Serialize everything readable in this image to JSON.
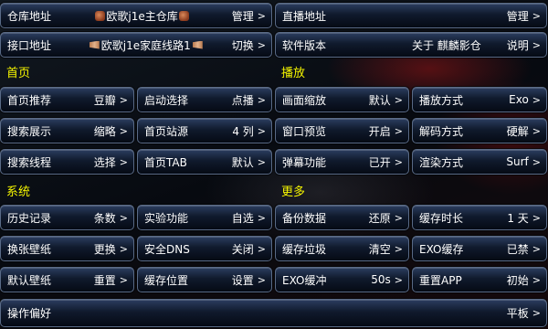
{
  "top": {
    "repo": {
      "label": "仓库地址",
      "value_pre": "",
      "value_mid": "欧歌j1e主仓库",
      "action": "管理"
    },
    "live": {
      "label": "直播地址",
      "action": "管理"
    },
    "api": {
      "label": "接口地址",
      "value_mid": "欧歌j1e家庭线路1",
      "action": "切换"
    },
    "version": {
      "label": "软件版本",
      "value": "关于 麒麟影仓",
      "action": "说明"
    }
  },
  "sections": {
    "home": "首页",
    "play": "播放",
    "system": "系统",
    "more": "更多"
  },
  "home_items": [
    {
      "label": "首页推荐",
      "value": "豆瓣"
    },
    {
      "label": "启动选择",
      "value": "点播"
    },
    {
      "label": "搜索展示",
      "value": "缩略"
    },
    {
      "label": "首页站源",
      "value": "4 列"
    },
    {
      "label": "搜索线程",
      "value": "选择"
    },
    {
      "label": "首页TAB",
      "value": "默认"
    }
  ],
  "play_items": [
    {
      "label": "画面缩放",
      "value": "默认"
    },
    {
      "label": "播放方式",
      "value": "Exo"
    },
    {
      "label": "窗口预览",
      "value": "开启"
    },
    {
      "label": "解码方式",
      "value": "硬解"
    },
    {
      "label": "弹幕功能",
      "value": "已开"
    },
    {
      "label": "渲染方式",
      "value": "Surf"
    }
  ],
  "system_items": [
    {
      "label": "历史记录",
      "value": "条数"
    },
    {
      "label": "实验功能",
      "value": "自选"
    },
    {
      "label": "换张壁纸",
      "value": "更换"
    },
    {
      "label": "安全DNS",
      "value": "关闭"
    },
    {
      "label": "默认壁纸",
      "value": "重置"
    },
    {
      "label": "缓存位置",
      "value": "设置"
    }
  ],
  "more_items": [
    {
      "label": "备份数据",
      "value": "还原"
    },
    {
      "label": "缓存时长",
      "value": "1 天"
    },
    {
      "label": "缓存垃圾",
      "value": "清空"
    },
    {
      "label": "EXO缓存",
      "value": "已禁"
    },
    {
      "label": "EXO缓冲",
      "value": "50s"
    },
    {
      "label": "重置APP",
      "value": "初始"
    }
  ],
  "bottom": {
    "label": "操作偏好",
    "value": "平板"
  },
  "chevron": ">",
  "colors": {
    "section": "#f5f500",
    "button_border": "#596a86"
  }
}
